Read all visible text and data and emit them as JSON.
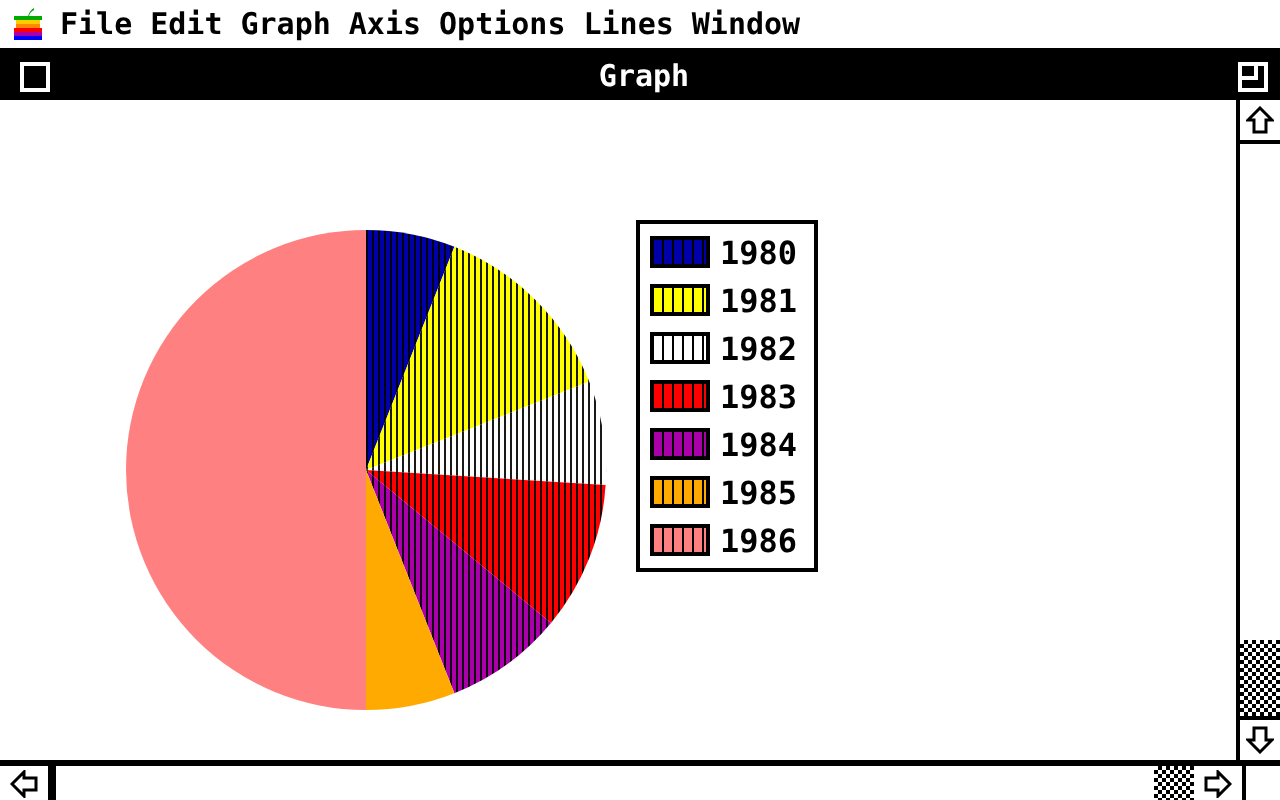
{
  "menu_bar": [
    "File",
    "Edit",
    "Graph",
    "Axis",
    "Options",
    "Lines",
    "Window"
  ],
  "window": {
    "title": "Graph"
  },
  "legend": [
    {
      "label": "1980",
      "color": "#0000aa"
    },
    {
      "label": "1981",
      "color": "#ffff00"
    },
    {
      "label": "1982",
      "color": "#ffffff"
    },
    {
      "label": "1983",
      "color": "#ff0000"
    },
    {
      "label": "1984",
      "color": "#aa00aa"
    },
    {
      "label": "1985",
      "color": "#ffaa00"
    },
    {
      "label": "1986",
      "color": "#ff8080"
    }
  ]
}
